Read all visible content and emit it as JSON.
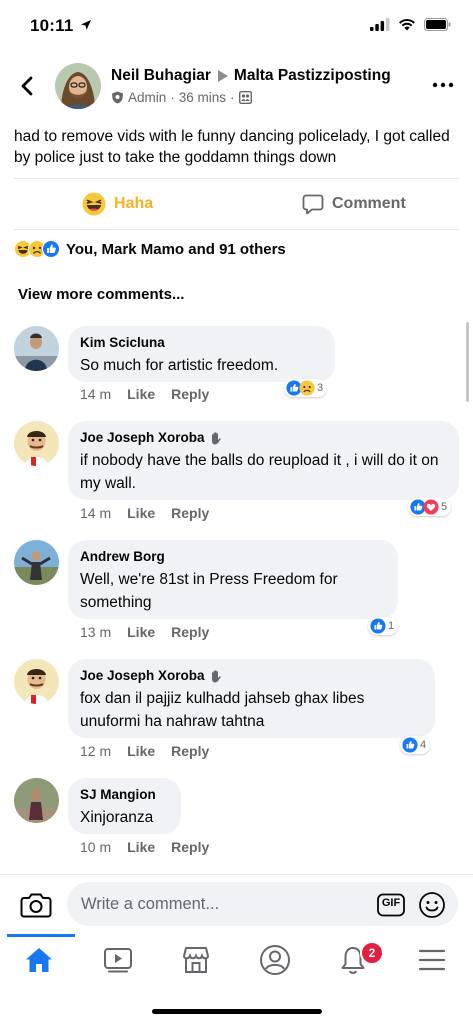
{
  "status_bar": {
    "time": "10:11"
  },
  "post": {
    "author": "Neil Buhagiar",
    "group": "Malta Pastizziposting",
    "role": "Admin",
    "time": "36 mins",
    "text": "had to remove vids with le funny dancing policelady, I got called by police just to take the goddamn things down"
  },
  "actions": {
    "reaction_label": "Haha",
    "comment_label": "Comment"
  },
  "reactions_summary": "You, Mark Mamo and 91 others",
  "view_more": "View more comments...",
  "comments": [
    {
      "author": "Kim Scicluna",
      "text": "So much for artistic freedom.",
      "time": "14 m",
      "like": "Like",
      "reply": "Reply",
      "reaction_count": "3"
    },
    {
      "author": "Joe Joseph Xoroba",
      "text": "if nobody have the balls do reupload it , i will do it on my wall.",
      "time": "14 m",
      "like": "Like",
      "reply": "Reply",
      "reaction_count": "5"
    },
    {
      "author": "Andrew Borg",
      "text": "Well, we're 81st in Press Freedom for something",
      "time": "13 m",
      "like": "Like",
      "reply": "Reply",
      "reaction_count": "1"
    },
    {
      "author": "Joe Joseph Xoroba",
      "text": "fox dan il pajjiz kulhadd jahseb ghax libes unuformi ha nahraw tahtna",
      "time": "12 m",
      "like": "Like",
      "reply": "Reply",
      "reaction_count": "4"
    },
    {
      "author": "SJ Mangion",
      "text": "Xinjoranza",
      "time": "10 m",
      "like": "Like",
      "reply": "Reply"
    }
  ],
  "composer": {
    "placeholder": "Write a comment...",
    "gif_label": "GIF"
  },
  "tabbar": {
    "notifications_badge": "2"
  },
  "colors": {
    "accent": "#1877f2",
    "haha": "#f7b125",
    "bubble": "#f0f2f5",
    "badge": "#e41e3f"
  }
}
